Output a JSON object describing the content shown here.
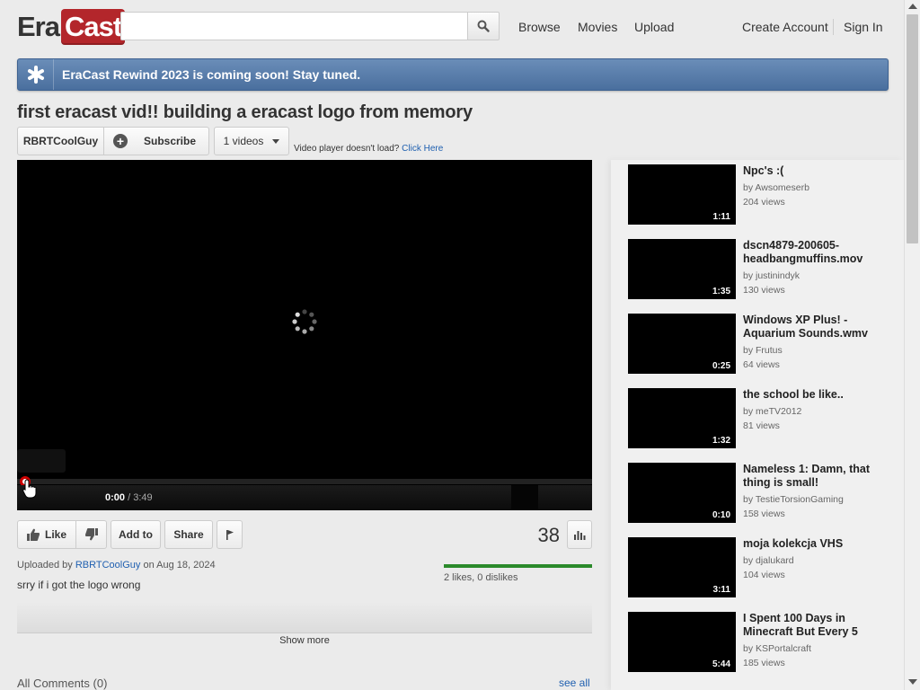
{
  "header": {
    "logo_part1": "Era",
    "logo_part2": "Cast",
    "search_value": "",
    "nav": [
      "Browse",
      "Movies",
      "Upload"
    ],
    "account": [
      "Create Account",
      "Sign In"
    ]
  },
  "banner": {
    "text": "EraCast Rewind 2023 is coming soon! Stay tuned."
  },
  "video": {
    "title": "first eracast vid!! building a eracast logo from memory",
    "channel": "RBRTCoolGuy",
    "subscribe_label": "Subscribe",
    "videos_label": "1 videos",
    "player_help": "Video player doesn't load?",
    "player_help_link": "Click Here",
    "time_current": "0:00",
    "time_total": "/ 3:49",
    "like_label": "Like",
    "addto_label": "Add to",
    "share_label": "Share",
    "view_count": "38",
    "uploaded_prefix": "Uploaded by",
    "uploader": "RBRTCoolGuy",
    "upload_date": "on Aug 18, 2024",
    "description": "srry if i got the logo wrong",
    "likes_text": "2 likes, 0 dislikes",
    "like_ratio": 1.0,
    "show_more": "Show more",
    "comments_title": "All Comments (0)",
    "see_all": "see all"
  },
  "related": [
    {
      "title": "Npc's :(",
      "author": "by Awsomeserb",
      "views": "204 views",
      "duration": "1:11"
    },
    {
      "title": "dscn4879-200605-headbangmuffins.mov",
      "author": "by justinindyk",
      "views": "130 views",
      "duration": "1:35"
    },
    {
      "title": "Windows XP Plus! - Aquarium Sounds.wmv",
      "author": "by Frutus",
      "views": "64 views",
      "duration": "0:25"
    },
    {
      "title": "the school be like..",
      "author": "by meTV2012",
      "views": "81 views",
      "duration": "1:32"
    },
    {
      "title": "Nameless 1: Damn, that thing is small!",
      "author": "by TestieTorsionGaming",
      "views": "158 views",
      "duration": "0:10"
    },
    {
      "title": "moja kolekcja VHS",
      "author": "by djalukard",
      "views": "104 views",
      "duration": "3:11"
    },
    {
      "title": "I Spent 100 Days in Minecraft But Every 5",
      "author": "by KSPortalcraft",
      "views": "185 views",
      "duration": "5:44"
    }
  ],
  "colors": {
    "logo_red": "#b3262b",
    "banner_blue": "#5a7eab",
    "link_blue": "#2060b0",
    "like_green": "#2b8a2b"
  }
}
